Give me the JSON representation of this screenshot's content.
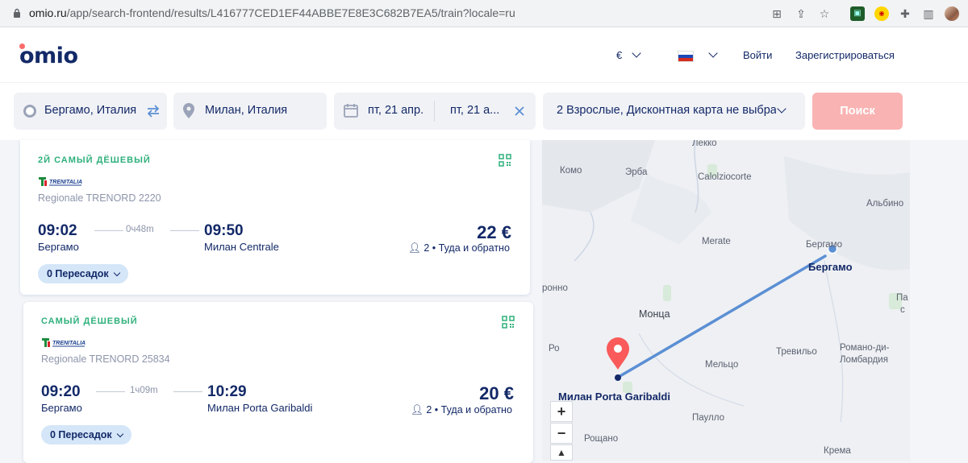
{
  "browser": {
    "url_host": "omio.ru",
    "url_path": "/app/search-frontend/results/L416777CED1EF44ABBE7E8E3C682B7EA5/train?locale=ru"
  },
  "header": {
    "logo": "omio",
    "currency": "€",
    "login": "Войти",
    "register": "Зарегистрироваться"
  },
  "search": {
    "from": "Бергамо, Италия",
    "to": "Милан, Италия",
    "date_out": "пт, 21 апр.",
    "date_back": "пт, 21 а...",
    "passengers": "2 Взрослые, Дисконтная карта не выбрана",
    "button": "Поиск"
  },
  "results": [
    {
      "badge": "2Й САМЫЙ ДЁШЕВЫЙ",
      "train": "Regionale TRENORD 2220",
      "dep_time": "09:02",
      "dep_station": "Бергамо",
      "duration": "0ч48m",
      "arr_time": "09:50",
      "arr_station": "Милан Centrale",
      "price": "22 €",
      "pax_info": "2 • Туда и обратно",
      "stops": "0 Пересадок"
    },
    {
      "badge": "САМЫЙ ДЁШЕВЫЙ",
      "train": "Regionale TRENORD 25834",
      "dep_time": "09:20",
      "dep_station": "Бергамо",
      "duration": "1ч09m",
      "arr_time": "10:29",
      "arr_station": "Милан Porta Garibaldi",
      "price": "20 €",
      "pax_info": "2 • Туда и обратно",
      "stops": "0 Пересадок"
    }
  ],
  "map": {
    "labels": [
      "Лекко",
      "Комо",
      "Эрба",
      "Calolziocorte",
      "Альбино",
      "Merate",
      "Бергамо",
      "ронно",
      "Монца",
      "Ро",
      "Тревильо",
      "Романо-ди-",
      "Ломбардия",
      "Мельцо",
      "Паулло",
      "Рощано",
      "Крема",
      "Па",
      "с"
    ],
    "origin_label": "Бергамо",
    "destination_label": "Милан Porta Garibaldi",
    "zoom_in": "+",
    "zoom_out": "−"
  },
  "colors": {
    "brand_navy": "#132968",
    "accent_coral": "#fa6b6b",
    "badge_green": "#2eb07b",
    "route_blue": "#5b8fd4"
  }
}
